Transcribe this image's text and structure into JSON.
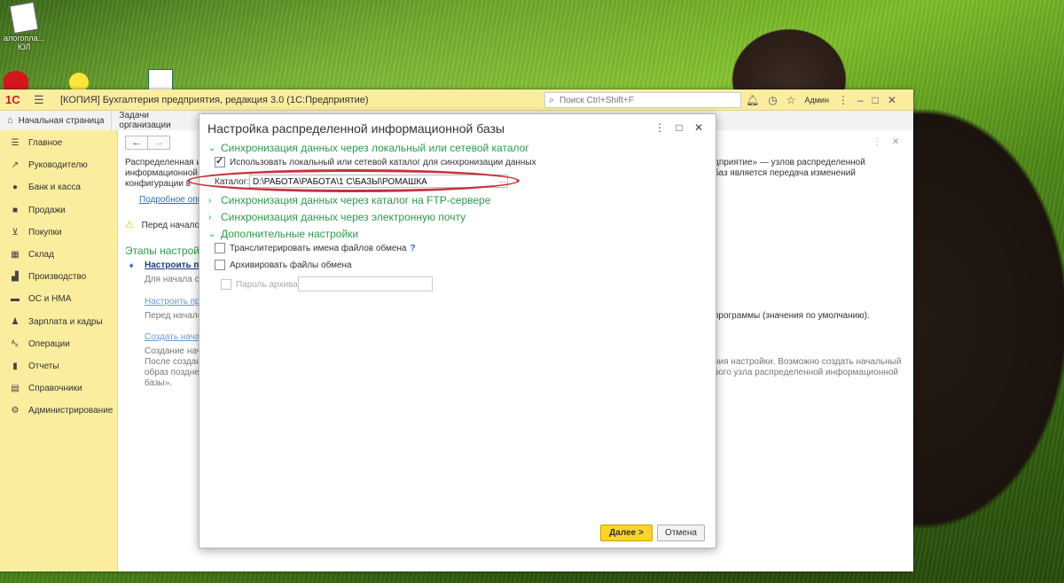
{
  "desktop": {
    "icon1_label": "алогопла... ЮЛ",
    "icon2_label": ""
  },
  "app": {
    "title": "[КОПИЯ] Бухгалтерия предприятия, редакция 3.0  (1С:Предприятие)",
    "logo": "1С",
    "search_placeholder": "Поиск Ctrl+Shift+F",
    "user": "Админ"
  },
  "tabs": [
    {
      "label": "Начальная страница",
      "icon": "home-icon"
    },
    {
      "label": "Задачи организации"
    }
  ],
  "sidebar": {
    "items": [
      {
        "label": "Главное",
        "icon": "menu-icon"
      },
      {
        "label": "Руководителю",
        "icon": "chart-trend-icon"
      },
      {
        "label": "Банк и касса",
        "icon": "coin-icon"
      },
      {
        "label": "Продажи",
        "icon": "bag-icon"
      },
      {
        "label": "Покупки",
        "icon": "cart-icon"
      },
      {
        "label": "Склад",
        "icon": "warehouse-icon"
      },
      {
        "label": "Производство",
        "icon": "factory-icon"
      },
      {
        "label": "ОС и НМА",
        "icon": "car-icon"
      },
      {
        "label": "Зарплата и кадры",
        "icon": "person-icon"
      },
      {
        "label": "Операции",
        "icon": "operations-icon"
      },
      {
        "label": "Отчеты",
        "icon": "bar-chart-icon"
      },
      {
        "label": "Справочники",
        "icon": "books-icon"
      },
      {
        "label": "Администрирование",
        "icon": "gear-icon"
      }
    ]
  },
  "content": {
    "intro1": "Распределенная и",
    "intro2": "информационной ба",
    "intro3": "конфигурации в",
    "intro_right1": "дприятие» — узлов распределенной",
    "intro_right2": "баз является передача изменений",
    "more_link": "Подробное опис",
    "warn_text": "Перед началом",
    "stages_title": "Этапы настройк",
    "step1_link": "Настроить па",
    "step1_desc": "Для начала си",
    "step2_link": "Настроить пра",
    "step2_desc": "Перед начало",
    "step2_right": "программы (значения по умолчанию).",
    "step3_link": "Создать начал",
    "step3_desc1": "Создание нача",
    "step3_desc2": "После создан",
    "step3_desc3": "образ поздне",
    "step3_desc4": "базы».",
    "step3_right1": "ния настройки. Возможно создать начальный",
    "step3_right2": "вого узла распределенной информационной"
  },
  "dialog": {
    "title": "Настройка распределенной информационной базы",
    "sec_local": "Синхронизация данных через локальный или сетевой каталог",
    "use_local_label": "Использовать локальный или сетевой каталог для синхронизации данных",
    "use_local_checked": true,
    "catalog_label": "Каталог:",
    "catalog_value": "D:\\РАБОТА\\РАБОТА\\1 С\\БАЗЫ\\РОМАШКА",
    "catalog_btn": "...",
    "sec_ftp": "Синхронизация данных через каталог на FTP-сервере",
    "sec_email": "Синхронизация данных через электронную почту",
    "sec_extra": "Дополнительные настройки",
    "transliterate_label": "Транслитерировать имена файлов обмена",
    "transliterate_help": "?",
    "archive_label": "Архивировать файлы обмена",
    "password_label": "Пароль архива",
    "next_btn": "Далее >",
    "cancel_btn": "Отмена"
  }
}
